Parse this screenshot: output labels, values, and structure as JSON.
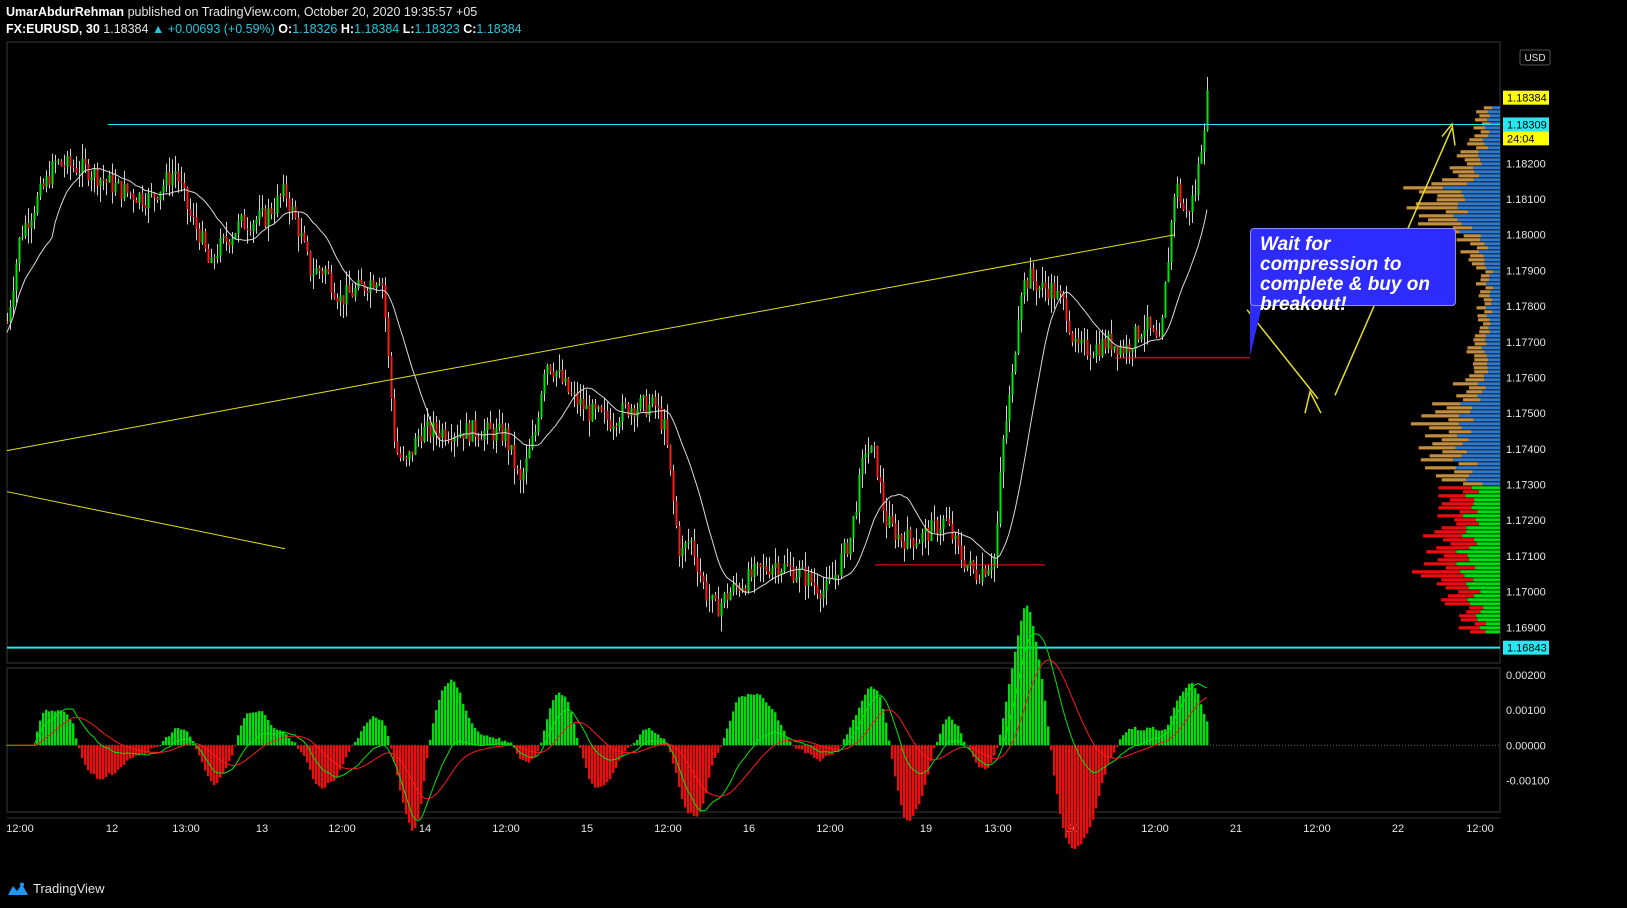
{
  "header": {
    "publisher": "UmarAbdurRehman",
    "published_text": "published on TradingView.com, October 20, 2020 19:35:57 +05",
    "symbol_line": "FX:EURUSD, 30",
    "last": "1.18384",
    "change": "▲ +0.00693 (+0.59%)",
    "o_label": "O:",
    "o": "1.18326",
    "h_label": "H:",
    "h": "1.18384",
    "l_label": "L:",
    "l": "1.18323",
    "c_label": "C:",
    "c": "1.18384"
  },
  "note": "Wait for compression to complete & buy on breakout!",
  "footer": {
    "brand": "TradingView"
  },
  "colors": {
    "up": "#00e60b",
    "down": "#ff1a1a",
    "cyan": "#26e7f2",
    "yellow": "#e6df1e",
    "ma": "#d9d9d9",
    "vp_blue": "#2d7ad1",
    "vp_green": "#00dd0a",
    "vp_red": "#ee0d0d",
    "vp_tan": "#c38e3d",
    "note_bg": "#2e2bff"
  },
  "chart_data": {
    "type": "candlestick",
    "currency": "USD",
    "y_range": [
      1.168,
      1.1854
    ],
    "y_ticks": [
      "1.18200",
      "1.18100",
      "1.18000",
      "1.17900",
      "1.17800",
      "1.17700",
      "1.17600",
      "1.17500",
      "1.17400",
      "1.17300",
      "1.17200",
      "1.17100",
      "1.17000",
      "1.16900"
    ],
    "x_ticks": [
      "12:00",
      "12",
      "13:00",
      "13",
      "12:00",
      "14",
      "12:00",
      "15",
      "12:00",
      "16",
      "12:00",
      "19",
      "13:00",
      "20",
      "12:00",
      "21",
      "12:00",
      "22",
      "12:00"
    ],
    "price_labels": [
      {
        "text": "1.18384",
        "price": 1.18384,
        "style": "yellow"
      },
      {
        "text": "24:04",
        "price": 1.1827,
        "style": "yellow"
      },
      {
        "text": "1.18309",
        "price": 1.18309,
        "style": "cyan"
      },
      {
        "text": "1.16843",
        "price": 1.16843,
        "style": "cyan"
      }
    ],
    "horizontal_levels": [
      1.18309,
      1.16843
    ],
    "macd": {
      "y_range": [
        -0.0019,
        0.0022
      ],
      "y_ticks": [
        "0.00200",
        "0.00100",
        "0.00000",
        "-0.00100"
      ]
    },
    "anchors": [
      [
        0,
        1.1775
      ],
      [
        4,
        1.177
      ],
      [
        20,
        1.18
      ],
      [
        55,
        1.182
      ],
      [
        90,
        1.1818
      ],
      [
        105,
        1.1815
      ],
      [
        125,
        1.1812
      ],
      [
        150,
        1.181
      ],
      [
        175,
        1.1818
      ],
      [
        190,
        1.1805
      ],
      [
        200,
        1.18
      ],
      [
        210,
        1.179
      ],
      [
        215,
        1.1795
      ],
      [
        240,
        1.1803
      ],
      [
        265,
        1.1805
      ],
      [
        285,
        1.1812
      ],
      [
        300,
        1.18
      ],
      [
        310,
        1.179
      ],
      [
        325,
        1.179
      ],
      [
        340,
        1.1782
      ],
      [
        360,
        1.1785
      ],
      [
        380,
        1.1789
      ],
      [
        383,
        1.1785
      ],
      [
        388,
        1.1765
      ],
      [
        395,
        1.174
      ],
      [
        405,
        1.1735
      ],
      [
        420,
        1.1745
      ],
      [
        440,
        1.1745
      ],
      [
        460,
        1.1745
      ],
      [
        480,
        1.1745
      ],
      [
        505,
        1.1744
      ],
      [
        520,
        1.173
      ],
      [
        535,
        1.1745
      ],
      [
        545,
        1.1765
      ],
      [
        555,
        1.1762
      ],
      [
        570,
        1.1755
      ],
      [
        590,
        1.175
      ],
      [
        610,
        1.1748
      ],
      [
        630,
        1.1752
      ],
      [
        655,
        1.1752
      ],
      [
        665,
        1.1745
      ],
      [
        675,
        1.172
      ],
      [
        680,
        1.171
      ],
      [
        690,
        1.1715
      ],
      [
        705,
        1.17
      ],
      [
        715,
        1.1695
      ],
      [
        730,
        1.17
      ],
      [
        755,
        1.1705
      ],
      [
        775,
        1.1708
      ],
      [
        800,
        1.1705
      ],
      [
        825,
        1.17
      ],
      [
        835,
        1.1705
      ],
      [
        850,
        1.1715
      ],
      [
        865,
        1.174
      ],
      [
        875,
        1.1738
      ],
      [
        885,
        1.172
      ],
      [
        900,
        1.1715
      ],
      [
        920,
        1.1715
      ],
      [
        945,
        1.172
      ],
      [
        960,
        1.171
      ],
      [
        975,
        1.1705
      ],
      [
        985,
        1.1707
      ],
      [
        995,
        1.171
      ],
      [
        1002,
        1.174
      ],
      [
        1012,
        1.176
      ],
      [
        1020,
        1.1785
      ],
      [
        1030,
        1.1788
      ],
      [
        1040,
        1.1785
      ],
      [
        1050,
        1.1785
      ],
      [
        1065,
        1.178
      ],
      [
        1075,
        1.1768
      ],
      [
        1090,
        1.1768
      ],
      [
        1110,
        1.177
      ],
      [
        1125,
        1.1768
      ],
      [
        1145,
        1.1775
      ],
      [
        1160,
        1.1768
      ],
      [
        1165,
        1.1785
      ],
      [
        1175,
        1.1815
      ],
      [
        1185,
        1.1805
      ],
      [
        1195,
        1.1812
      ],
      [
        1203,
        1.183
      ],
      [
        1207,
        1.18384
      ]
    ]
  }
}
